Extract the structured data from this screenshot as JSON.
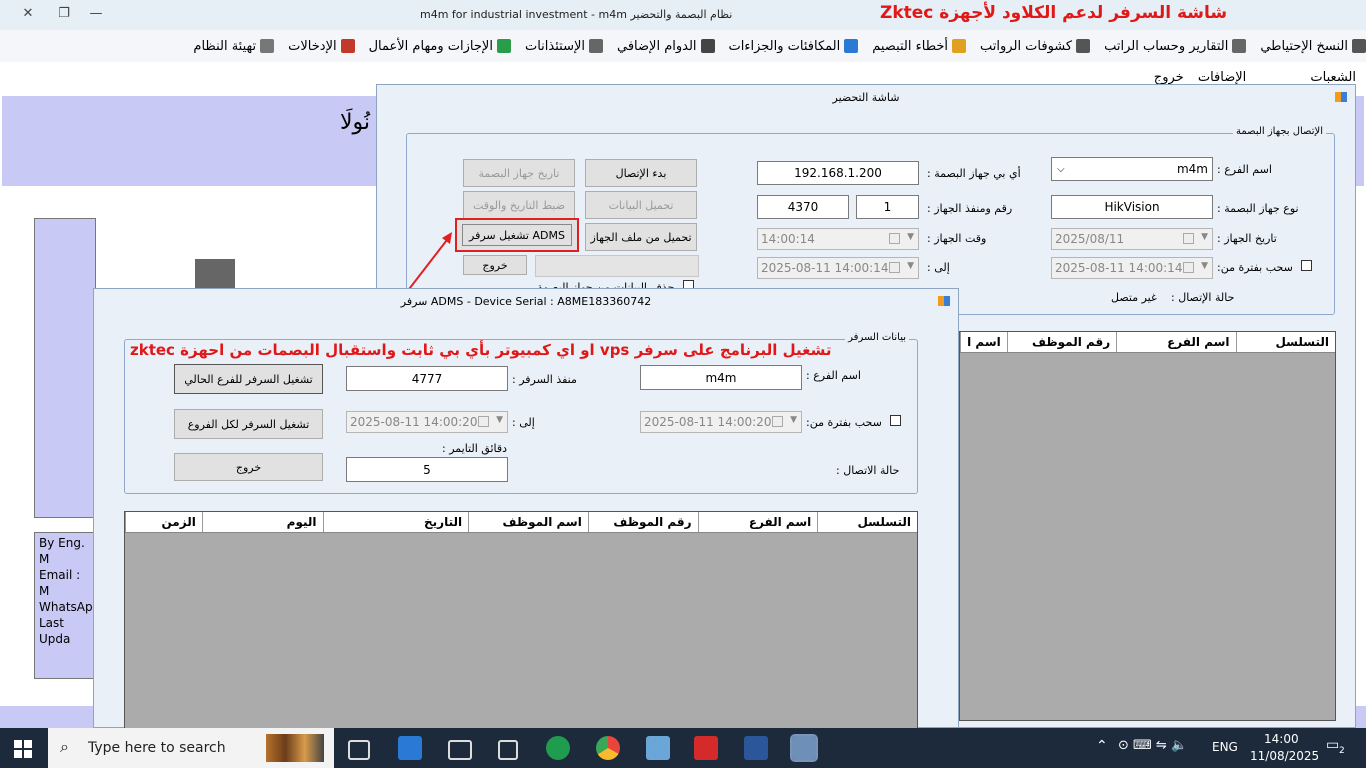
{
  "window": {
    "title": "m4m for industrial investment - m4m     نظام البصمة والتحضير",
    "promo_title": "شاشة السرفر لدعم الكلاود لأجهزة  Zktec"
  },
  "menu": [
    {
      "label": "تهيئة النظام",
      "icon": "settings-icon"
    },
    {
      "label": "الإدخالات",
      "icon": "calendar-icon"
    },
    {
      "label": "الإجازات ومهام الأعمال",
      "icon": "shield-icon"
    },
    {
      "label": "الإستئذانات",
      "icon": "gear-icon"
    },
    {
      "label": "الدوام الإضافي",
      "icon": "pen-icon"
    },
    {
      "label": "المكافئات والجزاءات",
      "icon": "chart-icon"
    },
    {
      "label": "أخطاء التبصيم",
      "icon": "bottles-icon"
    },
    {
      "label": "كشوفات الرواتب",
      "icon": "id-card-icon"
    },
    {
      "label": "التقارير وحساب الراتب",
      "icon": "printer-icon"
    },
    {
      "label": "النسخ الإحتياطي",
      "icon": "hand-icon"
    }
  ],
  "submenu": {
    "item1": "الشعبات",
    "item2": "الإضافات",
    "item3": "خروج"
  },
  "background": {
    "heading_fragment": "نُولَا",
    "info_lines": [
      "By Eng. M",
      "Email : M",
      "WhatsApp",
      "Last Upda"
    ]
  },
  "prep": {
    "title": "شاشة التحضير",
    "group_label": "الإتصال بجهاز البصمة",
    "branch_label": "اسم الفرع :",
    "branch_value": "m4m",
    "ip_label": "أي بي جهاز البصمة :",
    "ip_value": "192.168.1.200",
    "type_label": "نوع جهاز البصمة :",
    "type_value": "HikVision",
    "port_label": "رقم ومنفذ الجهاز :",
    "device_no": "1",
    "port_value": "4370",
    "devdate_label": "تاريخ الجهاز :",
    "devdate_value": "2025/08/11",
    "devtime_label": "وقت الجهاز :",
    "devtime_value": "14:00:14",
    "pull_label": "سحب بفترة من:",
    "from_value": "2025-08-11 14:00:14",
    "to_label": "إلى :",
    "to_value": "2025-08-11 14:00:14",
    "status_label": "حالة الإتصال :",
    "status_value": "غير متصل",
    "btn_connect": "بدء الإتصال",
    "btn_dev_date": "تاريخ جهاز البصمة",
    "btn_load": "تحميل البيانات",
    "btn_set_dt": "ضبط التاريخ والوقت",
    "btn_load_file": "تحميل من ملف الجهاز",
    "btn_adms": "تشغيل سرفر ADMS",
    "btn_exit": "خروج",
    "delete_text": "حذف البيانات من جهاز البصمة",
    "cols": [
      "التسلسل",
      "اسم الفرع",
      "رقم الموظف",
      "اسم ا"
    ]
  },
  "adms": {
    "title": "سرفر ADMS - Device Serial : A8ME183360742",
    "promo": "تشغيل البرنامج على سرفر vps او اي كمبيوتر بأي بي ثابت واستقبال البصمات من احهزة  zktec",
    "group_label": "بيانات السرفر",
    "branch_label": "اسم الفرع :",
    "branch_value": "m4m",
    "port_label": "منفذ السرفر :",
    "port_value": "4777",
    "pull_label": "سحب بفترة من:",
    "from_value": "2025-08-11 14:00:20",
    "to_label": "إلى :",
    "to_value": "2025-08-11 14:00:20",
    "timer_label": "دقائق التايمر :",
    "timer_value": "5",
    "status_label": "حالة الاتصال :",
    "btn_run_current": "تشغيل السرفر للفرع الحالي",
    "btn_run_all": "تشغيل السرفر لكل الفروع",
    "btn_exit": "خروج",
    "cols": [
      "التسلسل",
      "اسم الفرع",
      "رقم الموظف",
      "اسم الموظف",
      "التاريخ",
      "اليوم",
      "الزمن"
    ]
  },
  "taskbar": {
    "search_placeholder": "Type here to search",
    "lang": "ENG",
    "time": "14:00",
    "date": "11/08/2025",
    "notification_count": "2"
  },
  "colors": {
    "promo_red": "#e01818",
    "highlight_red": "#e02020",
    "desktop_panel": "#c9c9f5",
    "taskbar": "#1c2a3b"
  }
}
